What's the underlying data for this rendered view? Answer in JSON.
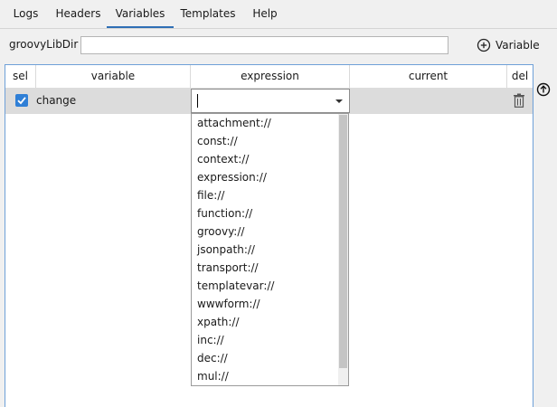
{
  "tabs": [
    {
      "label": "Logs"
    },
    {
      "label": "Headers"
    },
    {
      "label": "Variables"
    },
    {
      "label": "Templates"
    },
    {
      "label": "Help"
    }
  ],
  "active_tab": "Variables",
  "groovy_lib_dir": {
    "label": "groovyLibDir",
    "value": ""
  },
  "add_variable": {
    "label": "Variable",
    "icon": "plus-circle-icon"
  },
  "table": {
    "columns": [
      "sel",
      "variable",
      "expression",
      "current",
      "del"
    ],
    "rows": [
      {
        "selected": true,
        "variable": "change",
        "expression": "",
        "current": ""
      }
    ]
  },
  "dropdown": {
    "options": [
      "attachment://",
      "const://",
      "context://",
      "expression://",
      "file://",
      "function://",
      "groovy://",
      "jsonpath://",
      "transport://",
      "templatevar://",
      "wwwform://",
      "xpath://",
      "inc://",
      "dec://",
      "mul://"
    ]
  },
  "colors": {
    "accent": "#2f7fd6",
    "tab_underline": "#2f6fb5",
    "table_border": "#6ea0d8"
  }
}
